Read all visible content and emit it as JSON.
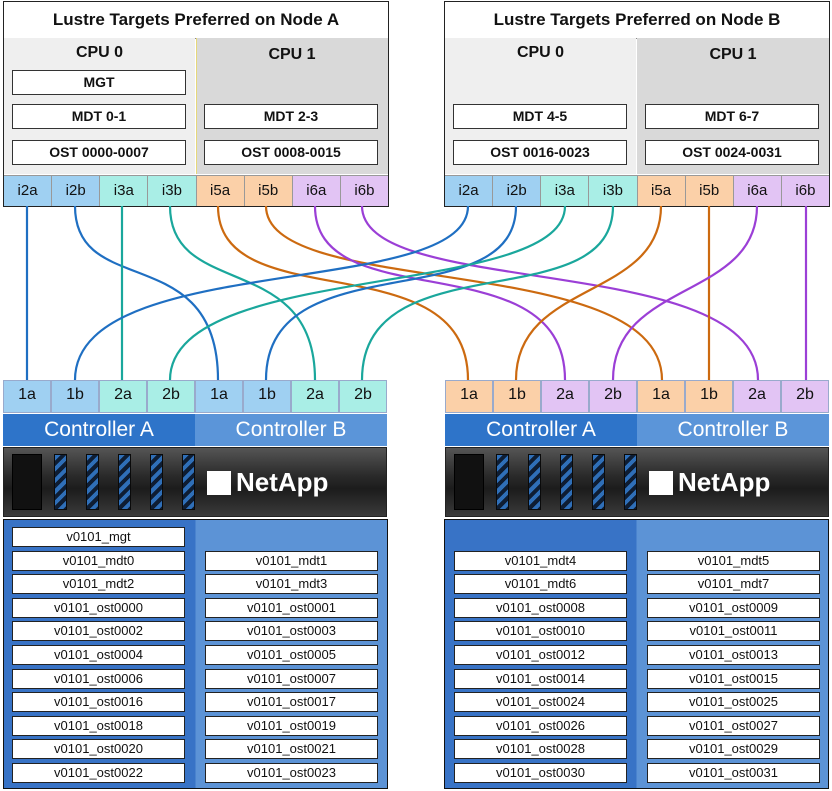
{
  "nodes": [
    {
      "title": "Lustre Targets Preferred on Node A",
      "cpu0": {
        "label": "CPU 0",
        "targets": [
          "MGT",
          "MDT 0-1",
          "OST 0000-0007"
        ]
      },
      "cpu1": {
        "label": "CPU 1",
        "targets": [
          "MDT 2-3",
          "OST 0008-0015"
        ]
      },
      "ports": [
        "i2a",
        "i2b",
        "i3a",
        "i3b",
        "i5a",
        "i5b",
        "i6a",
        "i6b"
      ]
    },
    {
      "title": "Lustre Targets Preferred on Node B",
      "cpu0": {
        "label": "CPU 0",
        "targets": [
          "MDT 4-5",
          "OST 0016-0023"
        ]
      },
      "cpu1": {
        "label": "CPU 1",
        "targets": [
          "MDT 6-7",
          "OST 0024-0031"
        ]
      },
      "ports": [
        "i2a",
        "i2b",
        "i3a",
        "i3b",
        "i5a",
        "i5b",
        "i6a",
        "i6b"
      ]
    }
  ],
  "arrays": [
    {
      "controllers": [
        "Controller A",
        "Controller B"
      ],
      "ports": [
        "1a",
        "1b",
        "2a",
        "2b",
        "1a",
        "1b",
        "2a",
        "2b"
      ],
      "brand": "NetApp",
      "volumes_a": [
        "v0101_mgt",
        "v0101_mdt0",
        "v0101_mdt2",
        "v0101_ost0000",
        "v0101_ost0002",
        "v0101_ost0004",
        "v0101_ost0006",
        "v0101_ost0016",
        "v0101_ost0018",
        "v0101_ost0020",
        "v0101_ost0022"
      ],
      "volumes_b": [
        "v0101_mdt1",
        "v0101_mdt3",
        "v0101_ost0001",
        "v0101_ost0003",
        "v0101_ost0005",
        "v0101_ost0007",
        "v0101_ost0017",
        "v0101_ost0019",
        "v0101_ost0021",
        "v0101_ost0023"
      ]
    },
    {
      "controllers": [
        "Controller A",
        "Controller B"
      ],
      "ports": [
        "1a",
        "1b",
        "2a",
        "2b",
        "1a",
        "1b",
        "2a",
        "2b"
      ],
      "brand": "NetApp",
      "volumes_a": [
        "v0101_mdt4",
        "v0101_mdt6",
        "v0101_ost0008",
        "v0101_ost0010",
        "v0101_ost0012",
        "v0101_ost0014",
        "v0101_ost0024",
        "v0101_ost0026",
        "v0101_ost0028",
        "v0101_ost0030"
      ],
      "volumes_b": [
        "v0101_mdt5",
        "v0101_mdt7",
        "v0101_ost0009",
        "v0101_ost0011",
        "v0101_ost0013",
        "v0101_ost0015",
        "v0101_ost0025",
        "v0101_ost0027",
        "v0101_ost0029",
        "v0101_ost0031"
      ]
    }
  ],
  "colors": {
    "port_blue": "#9fd0f2",
    "port_teal": "#a9eee6",
    "port_orange": "#fbd0a8",
    "port_purple": "#e2c4f4",
    "cable_blue": "#1f6fc2",
    "cable_teal": "#1aa79c",
    "cable_orange": "#cc6a10",
    "cable_purple": "#9b3fd6",
    "controller_a": "#2e74c9",
    "controller_b": "#5b95d9",
    "volume_panel_a": "#3873c6",
    "volume_panel_b": "#5c93d6"
  }
}
